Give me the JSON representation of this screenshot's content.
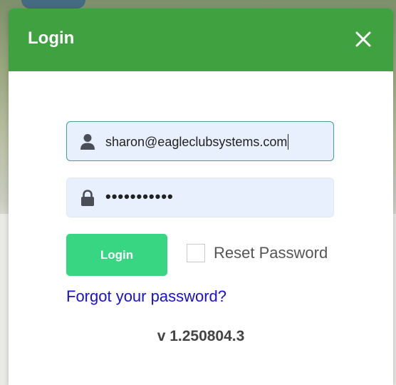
{
  "modal": {
    "title": "Login",
    "close_icon": "close-icon"
  },
  "form": {
    "email": {
      "icon": "user-icon",
      "value": "sharon@eagleclubsystems.com"
    },
    "password": {
      "icon": "lock-icon",
      "value": "•••••••••••"
    },
    "login_label": "Login",
    "reset_password_label": "Reset Password",
    "reset_password_checked": false,
    "forgot_link": "Forgot your password?"
  },
  "footer": {
    "version": "v 1.250804.3"
  },
  "colors": {
    "header": "#3fa13f",
    "login_button": "#38d683",
    "link": "#1a0fd6",
    "field_background": "#e8f0fd"
  }
}
